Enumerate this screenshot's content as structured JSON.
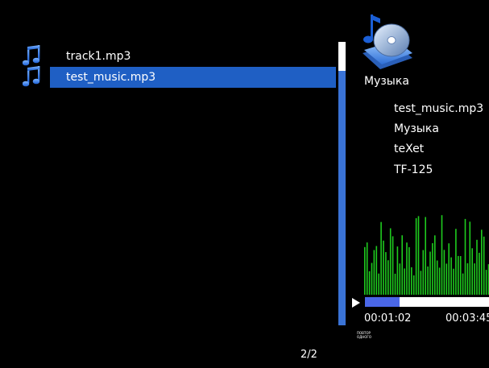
{
  "file_list": {
    "items": [
      {
        "name": "track1.mp3",
        "icon": "music-note-icon"
      },
      {
        "name": "test_music.mp3",
        "icon": "music-note-icon",
        "selected": true
      }
    ]
  },
  "now_playing": {
    "category": "Музыка",
    "title": "test_music.mp3",
    "album": "Музыка",
    "artist": "teXet",
    "model": "TF-125",
    "elapsed": "00:01:02",
    "total": "00:03:45",
    "progress_fraction": 0.28,
    "repeat_mode": "ПОВТОР ОДНОГО"
  },
  "pagination": {
    "label": "2/2"
  },
  "colors": {
    "selection": "#1f5fc4",
    "scrollbar": "#3a73d6",
    "progress_fill": "#4a67e8",
    "visualizer": "#1ecb1e"
  }
}
